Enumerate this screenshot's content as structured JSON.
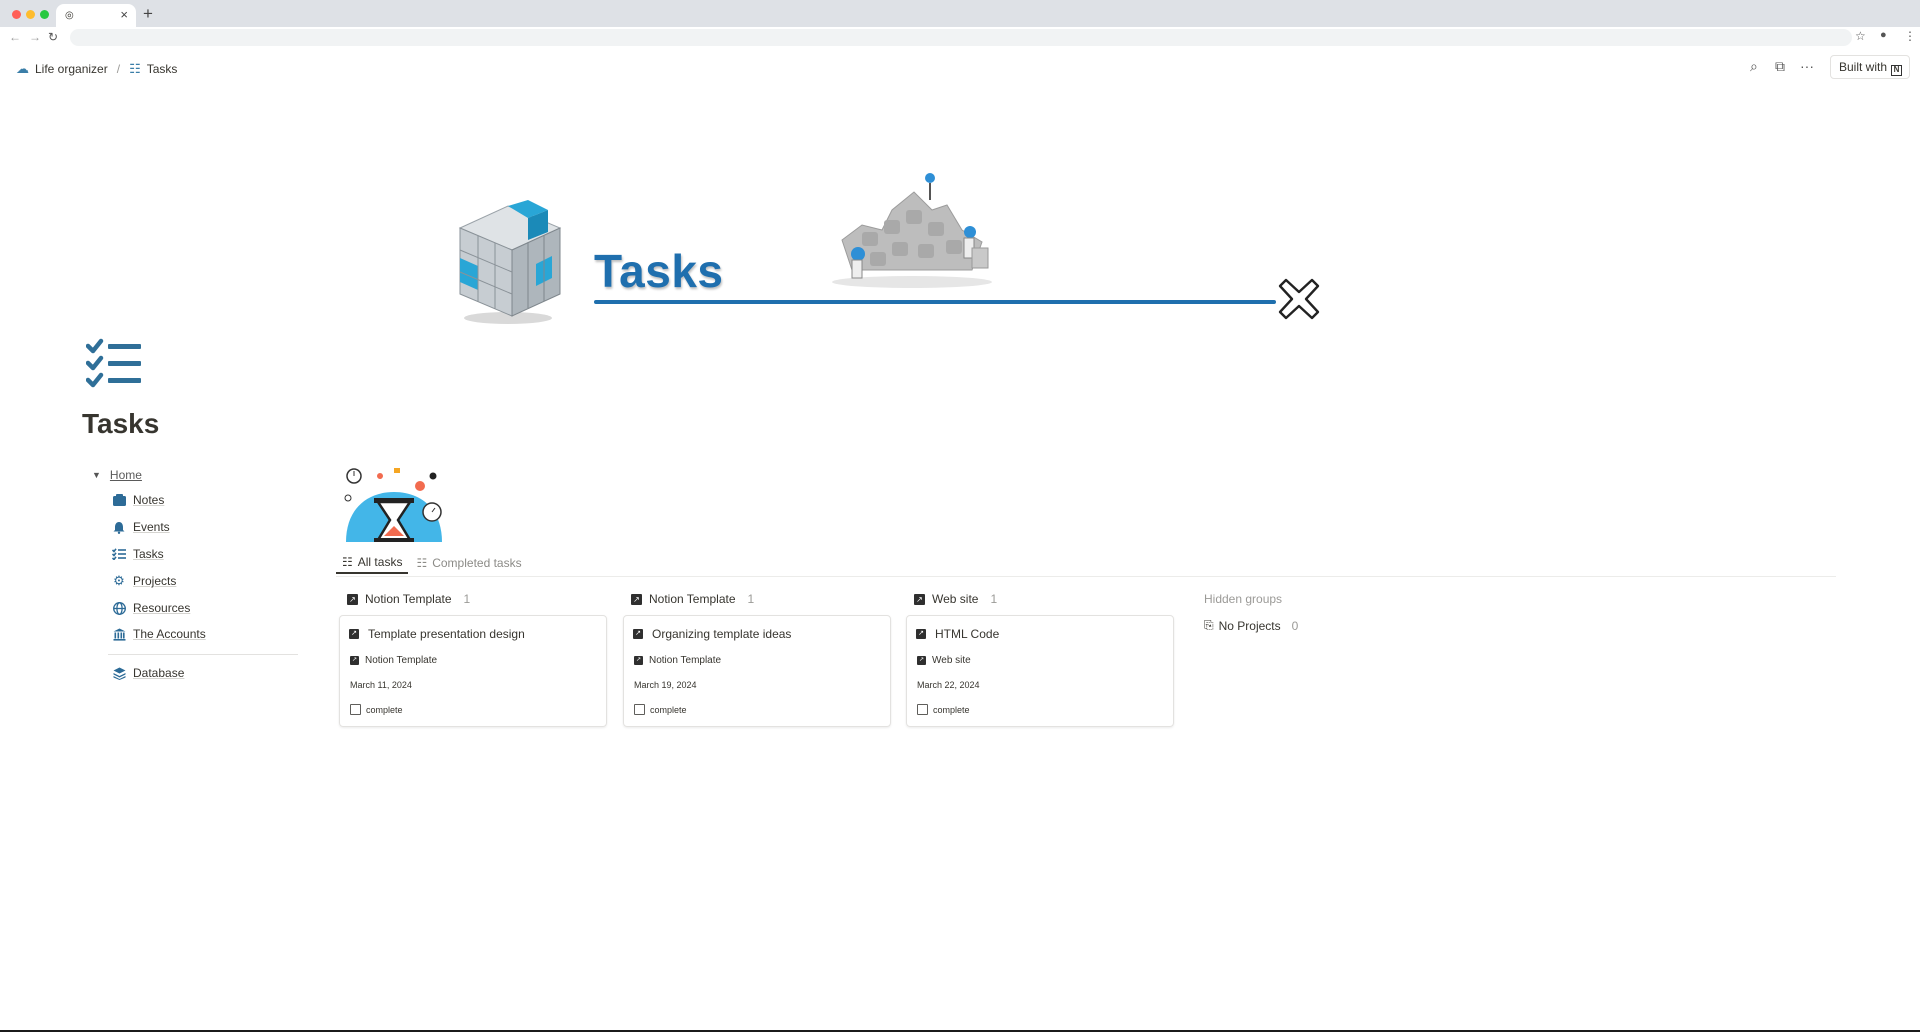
{
  "browser": {
    "tab_close": "×",
    "new_tab": "+"
  },
  "topbar": {
    "breadcrumb": [
      {
        "label": "Life organizer",
        "icon": "cloud-icon"
      },
      {
        "label": "Tasks",
        "icon": "task-list-icon"
      }
    ],
    "separator": "/",
    "built_with_label": "Built with"
  },
  "banner": {
    "title": "Tasks"
  },
  "page": {
    "title": "Tasks"
  },
  "sidebar": {
    "home_label": "Home",
    "items": [
      {
        "label": "Notes",
        "icon": "notes-box-icon"
      },
      {
        "label": "Events",
        "icon": "bell-icon"
      },
      {
        "label": "Tasks",
        "icon": "task-list-icon"
      },
      {
        "label": "Projects",
        "icon": "gear-icon"
      },
      {
        "label": "Resources",
        "icon": "globe-icon"
      },
      {
        "label": "The Accounts",
        "icon": "bank-icon"
      }
    ],
    "extra_items": [
      {
        "label": "Database",
        "icon": "stack-icon"
      }
    ]
  },
  "views": {
    "tabs": [
      {
        "label": "All tasks",
        "active": true
      },
      {
        "label": "Completed tasks",
        "active": false
      }
    ]
  },
  "board": {
    "columns": [
      {
        "title": "Notion Template",
        "count": "1",
        "cards": [
          {
            "title": "Template presentation design",
            "project": "Notion Template",
            "date": "March 11, 2024",
            "checkbox_label": "complete"
          }
        ]
      },
      {
        "title": "Notion Template",
        "count": "1",
        "cards": [
          {
            "title": "Organizing template ideas",
            "project": "Notion Template",
            "date": "March 19, 2024",
            "checkbox_label": "complete"
          }
        ]
      },
      {
        "title": "Web site",
        "count": "1",
        "cards": [
          {
            "title": "HTML Code",
            "project": "Web site",
            "date": "March 22, 2024",
            "checkbox_label": "complete"
          }
        ]
      }
    ],
    "hidden_groups_label": "Hidden groups",
    "hidden_groups": [
      {
        "label": "No Projects",
        "count": "0"
      }
    ]
  },
  "colors": {
    "accent_blue": "#1f6fae",
    "icon_blue": "#2d6b97",
    "text": "#37352f",
    "muted": "#9b9a97"
  }
}
